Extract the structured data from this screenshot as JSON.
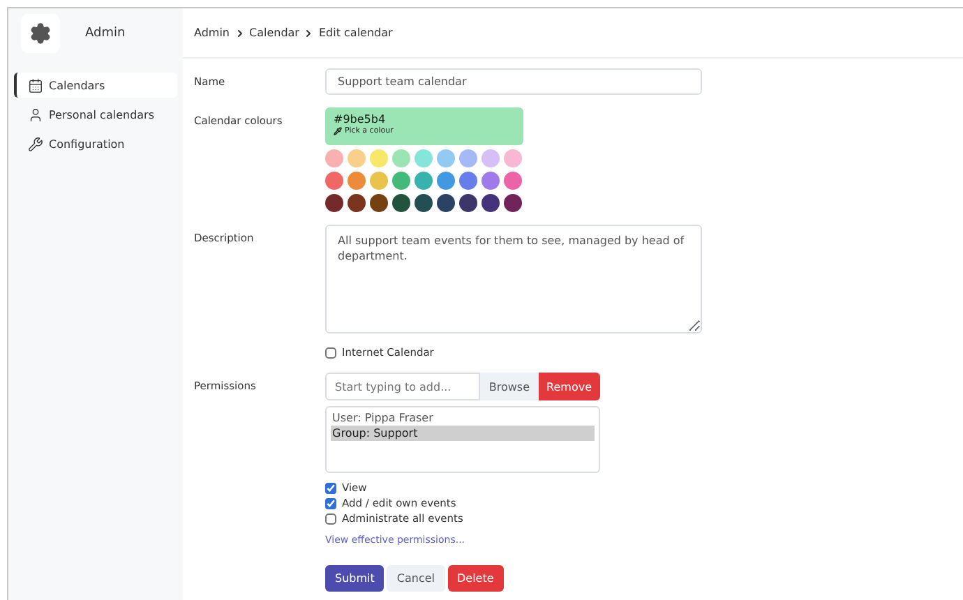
{
  "sidebar": {
    "title": "Admin",
    "items": [
      {
        "label": "Calendars",
        "selected": true
      },
      {
        "label": "Personal calendars",
        "selected": false
      },
      {
        "label": "Configuration",
        "selected": false
      }
    ]
  },
  "breadcrumb": [
    "Admin",
    "Calendar",
    "Edit calendar"
  ],
  "form": {
    "name": {
      "label": "Name",
      "value": "Support team calendar"
    },
    "colours": {
      "label": "Calendar colours",
      "value": "#9be5b4",
      "pick_label": "Pick a colour",
      "swatches": [
        {
          "color": "#f9b0b0"
        },
        {
          "color": "#f9d08a"
        },
        {
          "color": "#f7e86c"
        },
        {
          "color": "#9be5b4"
        },
        {
          "color": "#85e5d8"
        },
        {
          "color": "#92caf2"
        },
        {
          "color": "#a5b9f7"
        },
        {
          "color": "#d6bff7"
        },
        {
          "color": "#f8b7d3"
        },
        {
          "color": "#f06866"
        },
        {
          "color": "#ec8b3a"
        },
        {
          "color": "#e9c34c"
        },
        {
          "color": "#43b97a"
        },
        {
          "color": "#38b2ac"
        },
        {
          "color": "#4299e1"
        },
        {
          "color": "#667eea"
        },
        {
          "color": "#9f7aea"
        },
        {
          "color": "#ed64a6"
        },
        {
          "color": "#742a2a"
        },
        {
          "color": "#7b341e"
        },
        {
          "color": "#744210"
        },
        {
          "color": "#22543d"
        },
        {
          "color": "#234e52"
        },
        {
          "color": "#2a4365"
        },
        {
          "color": "#3c366b"
        },
        {
          "color": "#44337a"
        },
        {
          "color": "#702459"
        }
      ]
    },
    "description": {
      "label": "Description",
      "value": "All support team events for them to see, managed by head of department."
    },
    "internet_calendar": {
      "label": "Internet Calendar",
      "checked": false
    },
    "permissions": {
      "label": "Permissions",
      "placeholder": "Start typing to add...",
      "browse": "Browse",
      "remove": "Remove",
      "entries": [
        {
          "label": "User: Pippa Fraser",
          "selected": false
        },
        {
          "label": "Group: Support",
          "selected": true
        }
      ],
      "options": [
        {
          "label": "View",
          "checked": true
        },
        {
          "label": "Add / edit own events",
          "checked": true
        },
        {
          "label": "Administrate all events",
          "checked": false
        }
      ],
      "link": "View effective permissions..."
    },
    "buttons": [
      {
        "label": "Submit",
        "kind": "primary"
      },
      {
        "label": "Cancel",
        "kind": "secondary"
      },
      {
        "label": "Delete",
        "kind": "danger"
      }
    ]
  }
}
